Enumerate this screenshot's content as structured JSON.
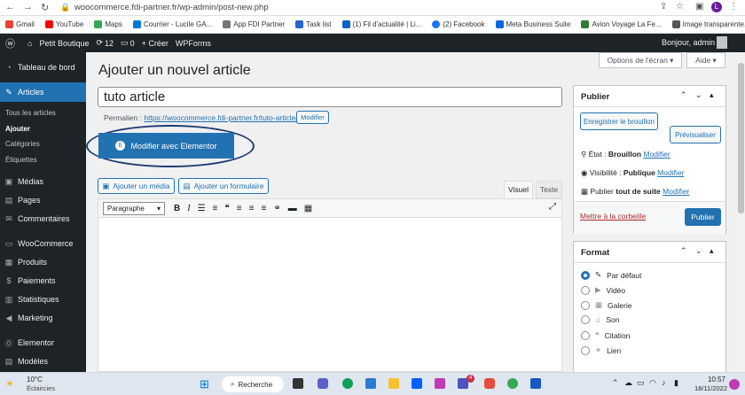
{
  "browser": {
    "url": "woocommerce.fdi-partner.fr/wp-admin/post-new.php",
    "profile": "L",
    "bookmarks": [
      "Gmail",
      "YouTube",
      "Maps",
      "Courrier - Lucile GA...",
      "App FDI Partner",
      "Task list",
      "(1) Fil d'actualité | Li...",
      "(2) Facebook",
      "Meta Business Suite",
      "Avion Voyage La Fe...",
      "Image transparente..."
    ]
  },
  "adminbar": {
    "site": "Petit Boutique",
    "updates": "12",
    "comments": "0",
    "new": "+ Créer",
    "wpforms": "WPForms",
    "greeting": "Bonjour, admin"
  },
  "sidebar": {
    "items": [
      "Tableau de bord",
      "Articles",
      "Médias",
      "Pages",
      "Commentaires",
      "WooCommerce",
      "Produits",
      "Paiements",
      "Statistiques",
      "Marketing",
      "Elementor",
      "Modèles"
    ],
    "sub": [
      "Tous les articles",
      "Ajouter",
      "Catégories",
      "Étiquettes"
    ]
  },
  "page": {
    "title": "Ajouter un nouvel article",
    "screen_options": "Options de l'écran ▾",
    "help": "Aide ▾",
    "post_title": "tuto article",
    "permalink_label": "Permalien :",
    "permalink_url": "https://woocommerce.fdi-partner.fr/tuto-article/",
    "permalink_btn": "Modifier",
    "elementor_btn": "Modifier avec Elementor",
    "add_media": "Ajouter un média",
    "add_form": "Ajouter un formulaire",
    "tab_visual": "Visuel",
    "tab_text": "Texte",
    "paragraph": "Paragraphe"
  },
  "publish": {
    "title": "Publier",
    "save_draft": "Enregistrer le brouillon",
    "preview": "Prévisualiser",
    "status_label": "État :",
    "status_value": "Brouillon",
    "visibility_label": "Visibilité :",
    "visibility_value": "Publique",
    "publish_label": "Publier",
    "publish_value": "tout de suite",
    "modify": "Modifier",
    "trash": "Mettre à la corbeille",
    "publish_btn": "Publier"
  },
  "format": {
    "title": "Format",
    "options": [
      "Par défaut",
      "Vidéo",
      "Galerie",
      "Son",
      "Citation",
      "Lien"
    ]
  },
  "taskbar": {
    "temp": "10°C",
    "weather": "Éclaircies",
    "search": "Recherche",
    "time": "10:57",
    "date": "18/11/2022",
    "badge": "4"
  }
}
